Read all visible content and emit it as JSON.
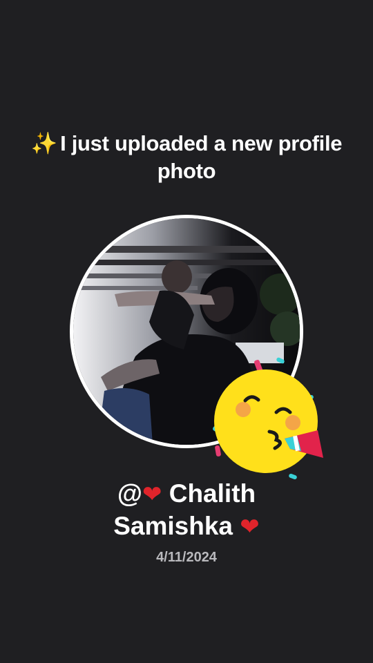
{
  "headline": {
    "icon": "sparkles-icon",
    "text": "I just uploaded a new profile photo"
  },
  "profile": {
    "photo_alt": "profile photo",
    "username_prefix": "@",
    "name_part1": "Chalith",
    "name_part2": "Samishka",
    "heart_glyph": "❤",
    "date": "4/11/2024"
  },
  "sticker": {
    "icon": "party-face-icon"
  },
  "colors": {
    "background": "#1f1f22",
    "ring": "#ffffff",
    "heart": "#e0242b",
    "party_face": "#ffe01b"
  }
}
